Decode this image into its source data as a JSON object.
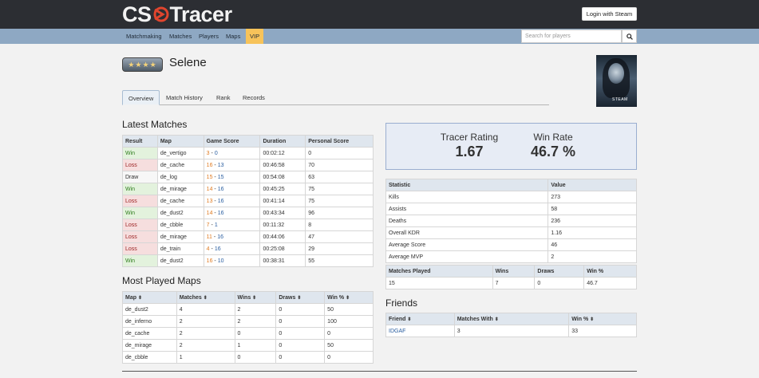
{
  "header": {
    "logo_left": "CS",
    "logo_right": "Tracer",
    "login_label": "Login with Steam"
  },
  "nav": {
    "items": [
      "Matchmaking",
      "Matches",
      "Players",
      "Maps"
    ],
    "vip_label": "VIP",
    "search_placeholder": "Search for players"
  },
  "profile": {
    "name": "Selene",
    "rank_stars": "★★★★",
    "avatar_caption": "STEAM"
  },
  "tabs": [
    "Overview",
    "Match History",
    "Rank",
    "Records"
  ],
  "latest_matches": {
    "title": "Latest Matches",
    "headers": [
      "Result",
      "Map",
      "Game Score",
      "Duration",
      "Personal Score"
    ],
    "rows": [
      {
        "result": "Win",
        "map": "de_vertigo",
        "a": "3",
        "sep": " - ",
        "b": "0",
        "duration": "00:02:12",
        "score": "0"
      },
      {
        "result": "Loss",
        "map": "de_cache",
        "a": "16",
        "sep": " - ",
        "b": "13",
        "duration": "00:46:58",
        "score": "70"
      },
      {
        "result": "Draw",
        "map": "de_log",
        "a": "15",
        "sep": " - ",
        "b": "15",
        "duration": "00:54:08",
        "score": "63"
      },
      {
        "result": "Win",
        "map": "de_mirage",
        "a": "14",
        "sep": " - ",
        "b": "16",
        "duration": "00:45:25",
        "score": "75"
      },
      {
        "result": "Loss",
        "map": "de_cache",
        "a": "13",
        "sep": " - ",
        "b": "16",
        "duration": "00:41:14",
        "score": "75"
      },
      {
        "result": "Win",
        "map": "de_dust2",
        "a": "14",
        "sep": " - ",
        "b": "16",
        "duration": "00:43:34",
        "score": "96"
      },
      {
        "result": "Loss",
        "map": "de_cbble",
        "a": "7",
        "sep": " - ",
        "b": "1",
        "duration": "00:11:32",
        "score": "8"
      },
      {
        "result": "Loss",
        "map": "de_mirage",
        "a": "11",
        "sep": " - ",
        "b": "16",
        "duration": "00:44:06",
        "score": "47"
      },
      {
        "result": "Loss",
        "map": "de_train",
        "a": "4",
        "sep": " - ",
        "b": "16",
        "duration": "00:25:08",
        "score": "29"
      },
      {
        "result": "Win",
        "map": "de_dust2",
        "a": "16",
        "sep": " - ",
        "b": "10",
        "duration": "00:38:31",
        "score": "55"
      }
    ]
  },
  "most_played": {
    "title": "Most Played Maps",
    "headers": [
      "Map",
      "Matches",
      "Wins",
      "Draws",
      "Win %"
    ],
    "sort_glyph": "⬍",
    "rows": [
      [
        "de_dust2",
        "4",
        "2",
        "0",
        "50"
      ],
      [
        "de_inferno",
        "2",
        "2",
        "0",
        "100"
      ],
      [
        "de_cache",
        "2",
        "0",
        "0",
        "0"
      ],
      [
        "de_mirage",
        "2",
        "1",
        "0",
        "50"
      ],
      [
        "de_cbble",
        "1",
        "0",
        "0",
        "0"
      ]
    ]
  },
  "rating": {
    "tracer_label": "Tracer Rating",
    "tracer_value": "1.67",
    "winrate_label": "Win Rate",
    "winrate_value": "46.7 %"
  },
  "stats": {
    "headers": [
      "Statistic",
      "Value"
    ],
    "rows": [
      [
        "Kills",
        "273"
      ],
      [
        "Assists",
        "58"
      ],
      [
        "Deaths",
        "236"
      ],
      [
        "Overall KDR",
        "1.16"
      ],
      [
        "Average Score",
        "46"
      ],
      [
        "Average MVP",
        "2"
      ]
    ]
  },
  "summary": {
    "headers": [
      "Matches Played",
      "Wins",
      "Draws",
      "Win %"
    ],
    "row": [
      "15",
      "7",
      "0",
      "46.7"
    ]
  },
  "friends": {
    "title": "Friends",
    "headers": [
      "Friend",
      "Matches With",
      "Win %"
    ],
    "rows": [
      [
        "IDGAF",
        "3",
        "33"
      ]
    ]
  }
}
